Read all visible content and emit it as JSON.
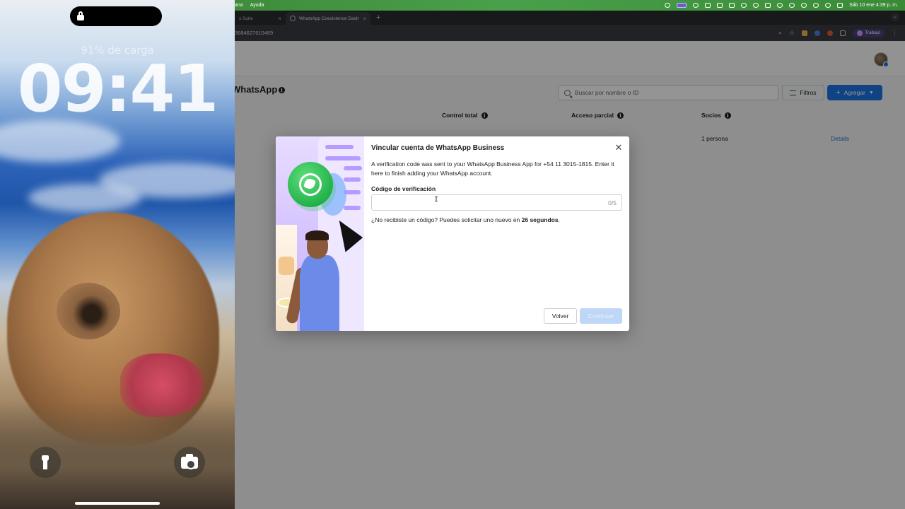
{
  "phone": {
    "charge_text": "91% de carga",
    "time": "09:41"
  },
  "mac_menu": {
    "items": [
      "ana",
      "Ayuda"
    ],
    "clock": "Sáb 10 ene  4:39 p. m."
  },
  "browser": {
    "tabs": [
      {
        "label": "s Suite",
        "active": false
      },
      {
        "label": "WhatsApp Coexistence Dash",
        "active": true
      }
    ],
    "new_tab": "+",
    "url": "3684627610469",
    "profile_label": "Trabajo"
  },
  "page": {
    "title": "WhatsApp",
    "search_placeholder": "Buscar por nombre o ID",
    "filter_label": "Filtros",
    "add_label": "Agregar",
    "columns": [
      "Control total",
      "Acceso parcial",
      "Socios"
    ],
    "row": {
      "socios": "1 persona",
      "details": "Details"
    }
  },
  "modal": {
    "title": "Vincular cuenta de WhatsApp Business",
    "description": "A verification code was sent to your WhatsApp Business App for +54 11 3015-1815. Enter it here to finish adding your WhatsApp account.",
    "field_label": "Código de verificación",
    "input_value": "",
    "counter": "0/5",
    "resend_prefix": "¿No recibiste un código? Puedes solicitar uno nuevo en ",
    "resend_seconds": "26 segundos",
    "resend_suffix": ".",
    "back_label": "Volver",
    "continue_label": "Continuar"
  },
  "colors": {
    "accent": "#1b74e4",
    "disabled_button": "#bfd7f7",
    "whatsapp_green": "#25d366"
  }
}
